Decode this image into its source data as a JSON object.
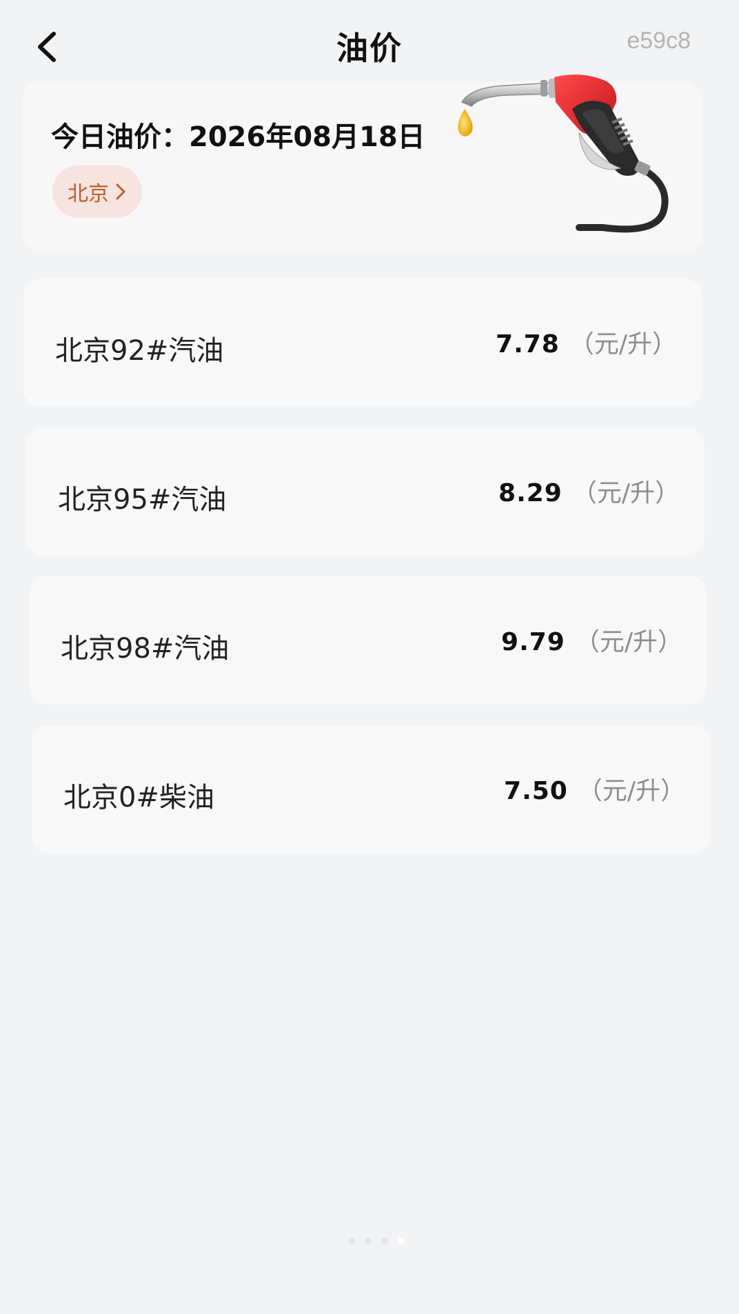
{
  "header": {
    "title": "油价",
    "code": "e59c8"
  },
  "hero": {
    "date_text": "今日油价：2026年08月18日",
    "city_label": "北京"
  },
  "prices": [
    {
      "name": "北京92#汽油",
      "value": "7.78",
      "unit": "（元/升）"
    },
    {
      "name": "北京95#汽油",
      "value": "8.29",
      "unit": "（元/升）"
    },
    {
      "name": "北京98#汽油",
      "value": "9.79",
      "unit": "（元/升）"
    },
    {
      "name": "北京0#柴油",
      "value": "7.50",
      "unit": "（元/升）"
    }
  ],
  "colors": {
    "accent_pill_bg": "#f7e3df",
    "accent_pill_text": "#b8602c",
    "page_bg": "#f2f3f5",
    "card_bg": "#f8f8f9"
  },
  "icons": {
    "back": "chevron-left-icon",
    "city": "chevron-right-icon",
    "hero_image": "fuel-pump-nozzle-icon"
  },
  "pager": {
    "count": 4,
    "active_index": 3
  }
}
